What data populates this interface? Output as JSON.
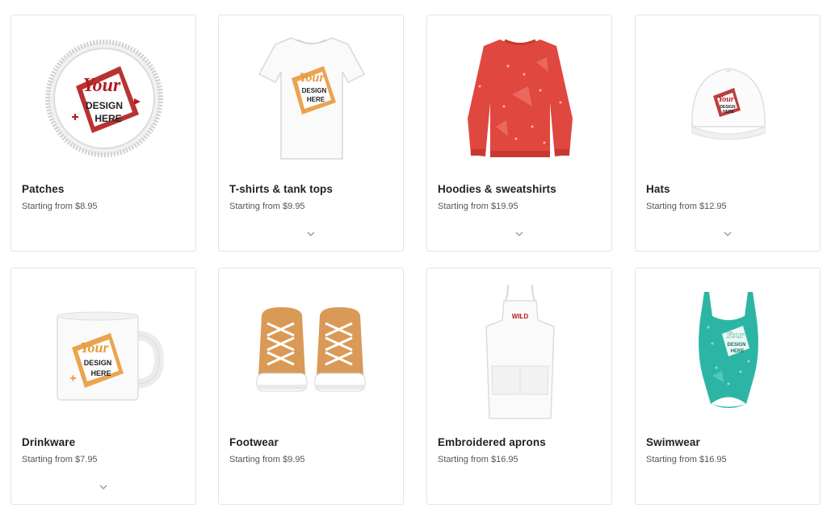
{
  "products": [
    {
      "title": "Patches",
      "price": "Starting from $8.95",
      "chevron": false,
      "art_text": [
        "Your",
        "DESIGN",
        "HERE"
      ]
    },
    {
      "title": "T-shirts & tank tops",
      "price": "Starting from $9.95",
      "chevron": true,
      "art_text": [
        "Your",
        "DESIGN",
        "HERE"
      ]
    },
    {
      "title": "Hoodies & sweatshirts",
      "price": "Starting from $19.95",
      "chevron": true
    },
    {
      "title": "Hats",
      "price": "Starting from $12.95",
      "chevron": true,
      "art_text": [
        "Your",
        "DESIGN",
        "HERE"
      ]
    },
    {
      "title": "Drinkware",
      "price": "Starting from $7.95",
      "chevron": true,
      "art_text": [
        "Your",
        "DESIGN",
        "HERE"
      ]
    },
    {
      "title": "Footwear",
      "price": "Starting from $9.95",
      "chevron": false
    },
    {
      "title": "Embroidered aprons",
      "price": "Starting from $16.95",
      "chevron": false,
      "art_text": [
        "WILD"
      ]
    },
    {
      "title": "Swimwear",
      "price": "Starting from $16.95",
      "chevron": false,
      "art_text": [
        "Your",
        "DESIGN",
        "HERE"
      ]
    }
  ],
  "colors": {
    "card_border": "#e3e3e3",
    "logo_red": "#b11c1c",
    "logo_orange": "#e89a3c",
    "hoodie_red": "#e0473f",
    "swim_teal": "#2cb5a5",
    "shoe_tan": "#d99a57"
  }
}
